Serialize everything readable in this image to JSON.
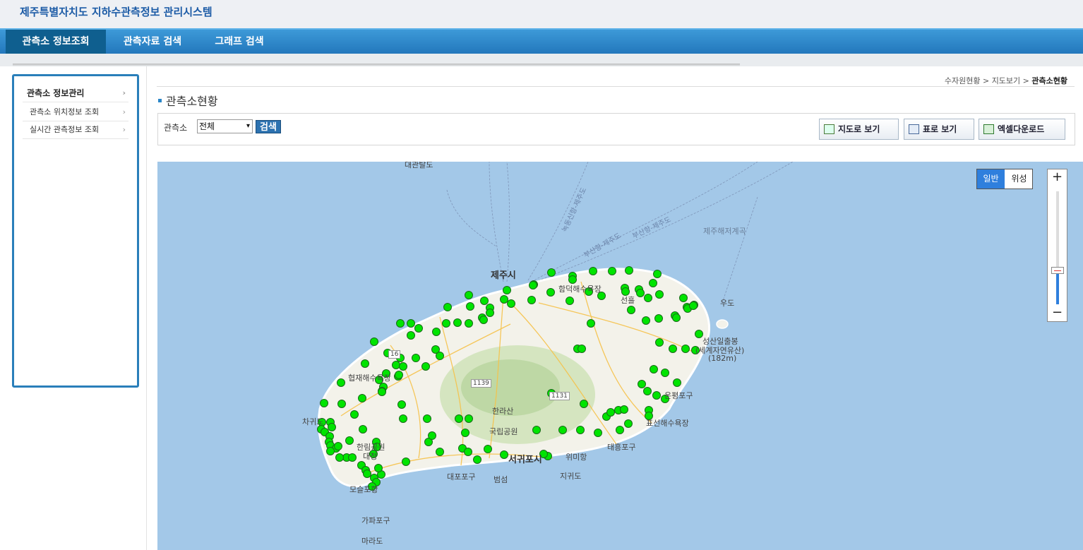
{
  "header": {
    "title": "제주특별자치도 지하수관측정보 관리시스템"
  },
  "nav": {
    "tabs": [
      {
        "label": "관측소 정보조회"
      },
      {
        "label": "관측자료 검색"
      },
      {
        "label": "그래프 검색"
      }
    ]
  },
  "sidebar": {
    "items": [
      {
        "label": "관측소 정보관리"
      },
      {
        "label": "관측소 위치정보 조회"
      },
      {
        "label": "실시간 관측정보 조회"
      }
    ]
  },
  "breadcrumb": {
    "part1": "수자원현황",
    "part2": "지도보기",
    "current": "관측소현황",
    "sep": ">"
  },
  "page": {
    "title": "관측소현황"
  },
  "filter": {
    "label": "관측소",
    "select_value": "전체",
    "search_label": "검색"
  },
  "actions": {
    "map_view": "지도로 보기",
    "table_view": "표로 보기",
    "excel": "엑셀다운로드"
  },
  "map": {
    "type_normal": "일반",
    "type_satellite": "위성",
    "zoom_in": "+",
    "zoom_out": "−",
    "zoom_level_fraction": 0.28,
    "marker_color": "#00e400",
    "labels": {
      "jeju_city": "제주시",
      "seogwipo": "서귀포시",
      "udo": "우도",
      "seongsan": "성산일출봉",
      "seongsan2": "(세계자연유산)",
      "seongsan3": "(182m)",
      "hallasan": "한라산",
      "hallasan2": "국립공원",
      "hyeopjae": "협재해수욕장",
      "hamdeok": "함덕해수욕장",
      "seonheul": "선흘",
      "daejeong": "대정",
      "chagwido": "차귀도",
      "mosulpo": "모슬포항",
      "gapa": "가파포구",
      "marado": "마라도",
      "daepo": "대포포구",
      "beomseom": "범섬",
      "jigwido": "지귀도",
      "wimi": "위미항",
      "taeheung": "태흥포구",
      "pyoseon": "표선해수욕장",
      "oson": "온평포구",
      "hallim": "한림공원",
      "jeju_sea": "제주해저계곡",
      "kwanj": "대관탈도",
      "route1": "부산항-제주도",
      "route2": "부산항-제주도",
      "route3": "녹동신항-제주도",
      "rd1139": "1139",
      "rd16": "16",
      "rd1131": "1131"
    }
  }
}
